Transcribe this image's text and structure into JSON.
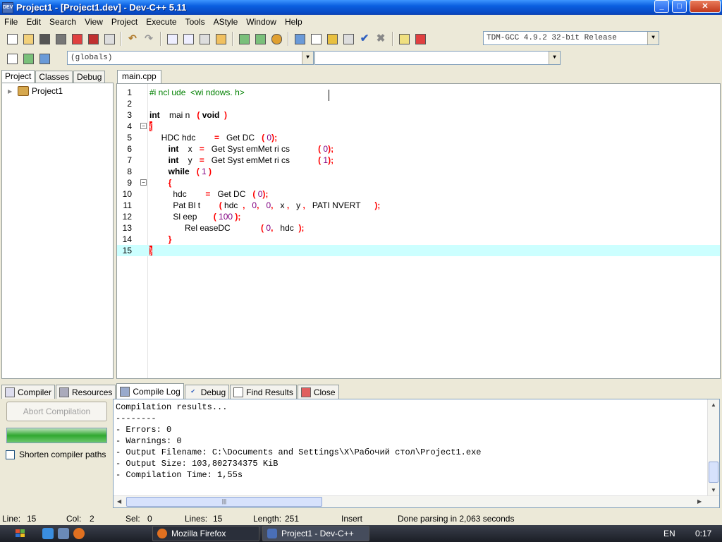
{
  "window": {
    "title": "Project1 - [Project1.dev] - Dev-C++ 5.11",
    "app_icon_text": "DEV",
    "min": "_",
    "max": "□",
    "close": "✕"
  },
  "menu": [
    "File",
    "Edit",
    "Search",
    "View",
    "Project",
    "Execute",
    "Tools",
    "AStyle",
    "Window",
    "Help"
  ],
  "toolbar": {
    "compiler": "TDM-GCC 4.9.2 32-bit Release",
    "scope": "(globals)",
    "members": ""
  },
  "left_panel": {
    "tabs": [
      "Project",
      "Classes",
      "Debug"
    ],
    "tree_root": "Project1"
  },
  "editor": {
    "tab": "main.cpp",
    "lines": [
      {
        "n": "1",
        "tokens": [
          {
            "t": "#i ncl ude  <wi ndows. h>",
            "c": "pp"
          }
        ]
      },
      {
        "n": "2",
        "tokens": []
      },
      {
        "n": "3",
        "tokens": [
          {
            "t": "int",
            "c": "kw"
          },
          {
            "t": "    mai n   "
          },
          {
            "t": "(",
            "c": "sym"
          },
          {
            "t": " void ",
            "c": "kw"
          },
          {
            "t": " )",
            "c": "sym"
          }
        ]
      },
      {
        "n": "4",
        "tokens": [
          {
            "t": "{",
            "c": "brace"
          }
        ]
      },
      {
        "n": "5",
        "tokens": [
          {
            "t": "     HDC hdc        "
          },
          {
            "t": "=",
            "c": "sym"
          },
          {
            "t": "   Get DC   "
          },
          {
            "t": "(",
            "c": "sym"
          },
          {
            "t": " 0",
            "c": "num"
          },
          {
            "t": ");",
            "c": "sym"
          }
        ]
      },
      {
        "n": "6",
        "tokens": [
          {
            "t": "        "
          },
          {
            "t": "int",
            "c": "kw"
          },
          {
            "t": "    x   "
          },
          {
            "t": "=",
            "c": "sym"
          },
          {
            "t": "   Get Syst emMet ri cs            "
          },
          {
            "t": "(",
            "c": "sym"
          },
          {
            "t": " 0",
            "c": "num"
          },
          {
            "t": ");",
            "c": "sym"
          }
        ]
      },
      {
        "n": "7",
        "tokens": [
          {
            "t": "        "
          },
          {
            "t": "int",
            "c": "kw"
          },
          {
            "t": "    y   "
          },
          {
            "t": "=",
            "c": "sym"
          },
          {
            "t": "   Get Syst emMet ri cs            "
          },
          {
            "t": "(",
            "c": "sym"
          },
          {
            "t": " 1",
            "c": "num"
          },
          {
            "t": ");",
            "c": "sym"
          }
        ]
      },
      {
        "n": "8",
        "tokens": [
          {
            "t": "        "
          },
          {
            "t": "while",
            "c": "kw"
          },
          {
            "t": "   "
          },
          {
            "t": "(",
            "c": "sym"
          },
          {
            "t": " 1",
            "c": "num"
          },
          {
            "t": " )",
            "c": "sym"
          }
        ]
      },
      {
        "n": "9",
        "tokens": [
          {
            "t": "        "
          },
          {
            "t": "{",
            "c": "sym"
          }
        ]
      },
      {
        "n": "10",
        "tokens": [
          {
            "t": "          hdc        "
          },
          {
            "t": "=",
            "c": "sym"
          },
          {
            "t": "   Get DC   "
          },
          {
            "t": "(",
            "c": "sym"
          },
          {
            "t": " 0",
            "c": "num"
          },
          {
            "t": ");",
            "c": "sym"
          }
        ]
      },
      {
        "n": "11",
        "tokens": [
          {
            "t": "          Pat Bl t        "
          },
          {
            "t": "(",
            "c": "sym"
          },
          {
            "t": " hdc  "
          },
          {
            "t": ",",
            "c": "sym"
          },
          {
            "t": "   0",
            "c": "num"
          },
          {
            "t": ",",
            "c": "sym"
          },
          {
            "t": "   0",
            "c": "num"
          },
          {
            "t": ",",
            "c": "sym"
          },
          {
            "t": "   x "
          },
          {
            "t": ",",
            "c": "sym"
          },
          {
            "t": "   y "
          },
          {
            "t": ",",
            "c": "sym"
          },
          {
            "t": "   PATI NVERT      "
          },
          {
            "t": ");",
            "c": "sym"
          }
        ]
      },
      {
        "n": "12",
        "tokens": [
          {
            "t": "          Sl eep       "
          },
          {
            "t": "(",
            "c": "sym"
          },
          {
            "t": " 100",
            "c": "num"
          },
          {
            "t": " );",
            "c": "sym"
          }
        ]
      },
      {
        "n": "13",
        "tokens": [
          {
            "t": "               Rel easeDC             "
          },
          {
            "t": "(",
            "c": "sym"
          },
          {
            "t": " 0",
            "c": "num"
          },
          {
            "t": ",",
            "c": "sym"
          },
          {
            "t": "   hdc  "
          },
          {
            "t": ");",
            "c": "sym"
          }
        ]
      },
      {
        "n": "14",
        "tokens": [
          {
            "t": "        "
          },
          {
            "t": "}",
            "c": "sym"
          }
        ]
      },
      {
        "n": "15",
        "tokens": [
          {
            "t": "}",
            "c": "brace"
          }
        ]
      }
    ]
  },
  "bottom_tabs": [
    "Compiler",
    "Resources",
    "Compile Log",
    "Debug",
    "Find Results",
    "Close"
  ],
  "compile_panel": {
    "abort_label": "Abort Compilation",
    "progress": 1.0,
    "shorten_label": "Shorten compiler paths"
  },
  "log": [
    "Compilation results...",
    "--------",
    "- Errors: 0",
    "- Warnings: 0",
    "- Output Filename: C:\\Documents and Settings\\X\\Рабочий стол\\Project1.exe",
    "- Output Size: 103,802734375 KiB",
    "- Compilation Time: 1,55s"
  ],
  "status": {
    "line_label": "Line:",
    "line_val": "15",
    "col_label": "Col:",
    "col_val": "2",
    "sel_label": "Sel:",
    "sel_val": "0",
    "lines_label": "Lines:",
    "lines_val": "15",
    "length_label": "Length:",
    "length_val": "251",
    "mode": "Insert",
    "message": "Done parsing in 2,063 seconds"
  },
  "taskbar": {
    "tasks": [
      "Mozilla Firefox",
      "Project1 - Dev-C++"
    ],
    "lang": "EN",
    "clock": "0:17"
  }
}
